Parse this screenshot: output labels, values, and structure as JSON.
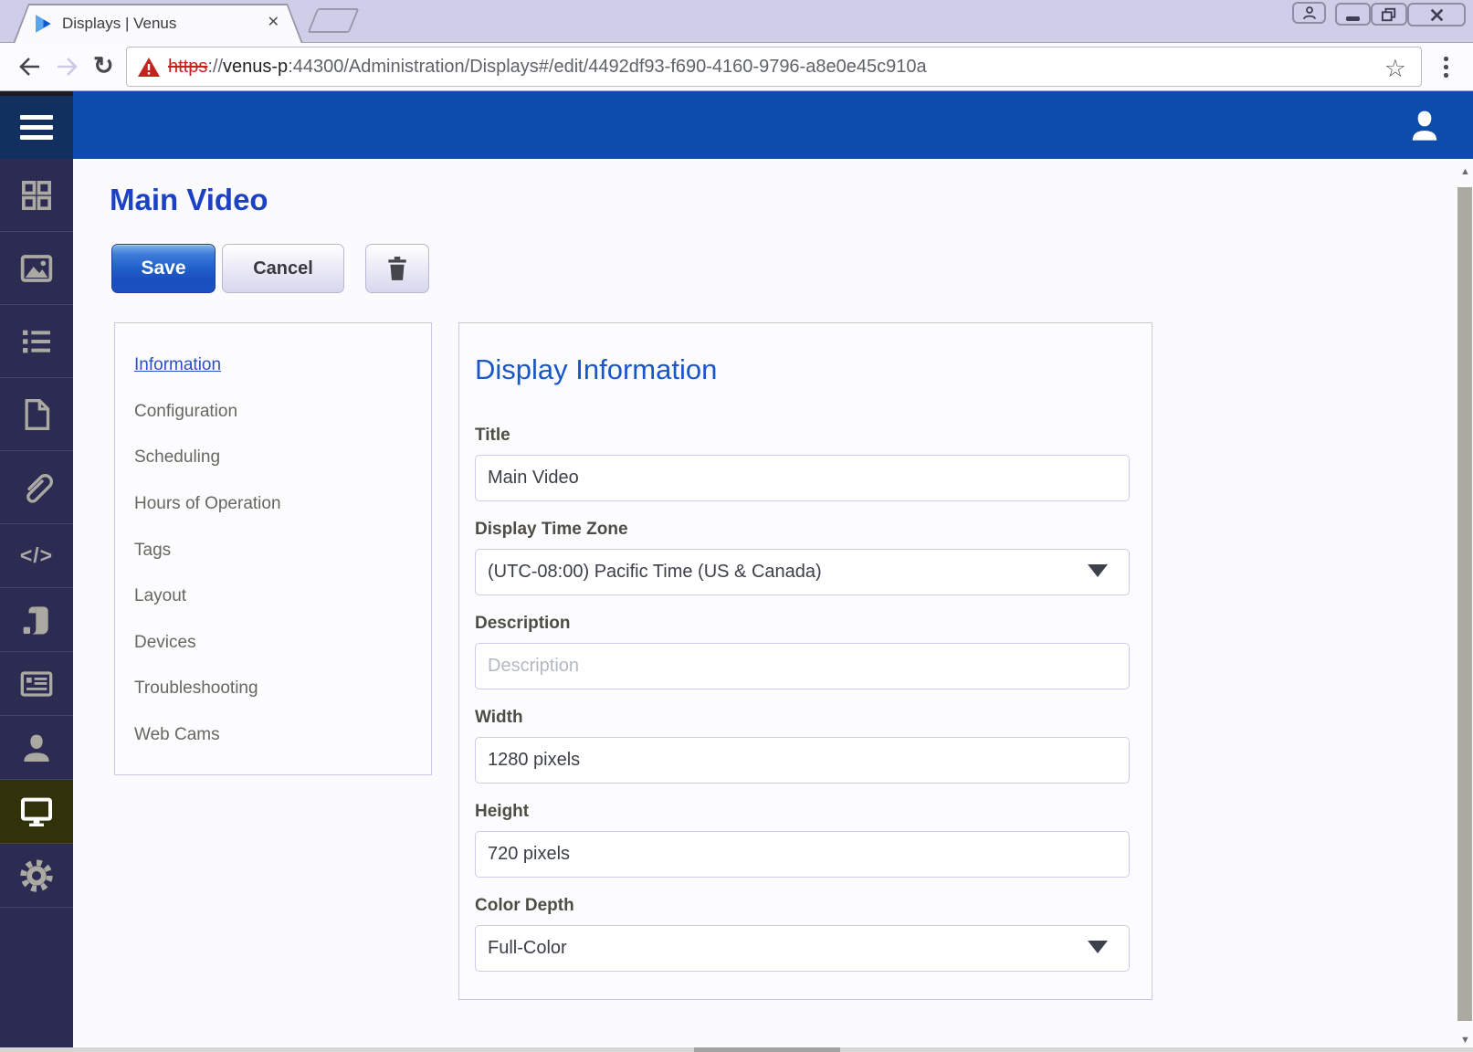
{
  "browser": {
    "tab": {
      "title": "Displays | Venus",
      "close_glyph": "✕"
    },
    "new_tab_button": true,
    "url": {
      "scheme": "https",
      "separator": "://",
      "host": "venus-p",
      "rest": ":44300/Administration/Displays#/edit/4492df93-f690-4160-9796-a8e0e45c910a"
    },
    "nav": {
      "reload": "↻",
      "bookmark_star": "☆"
    }
  },
  "app": {
    "page_title": "Main Video",
    "toolbar": {
      "save_label": "Save",
      "cancel_label": "Cancel"
    },
    "nav_panel": {
      "items": [
        {
          "label": "Information",
          "active": true
        },
        {
          "label": "Configuration"
        },
        {
          "label": "Scheduling"
        },
        {
          "label": "Hours of Operation"
        },
        {
          "label": "Tags"
        },
        {
          "label": "Layout"
        },
        {
          "label": "Devices"
        },
        {
          "label": "Troubleshooting"
        },
        {
          "label": "Web Cams"
        }
      ]
    },
    "form": {
      "heading": "Display Information",
      "fields": [
        {
          "label": "Title",
          "type": "text",
          "value": "Main Video"
        },
        {
          "label": "Display Time Zone",
          "type": "select",
          "value": "(UTC-08:00) Pacific Time (US & Canada)"
        },
        {
          "label": "Description",
          "type": "text",
          "value": "",
          "placeholder": "Description"
        },
        {
          "label": "Width",
          "type": "text",
          "value": "1280 pixels"
        },
        {
          "label": "Height",
          "type": "text",
          "value": "720 pixels"
        },
        {
          "label": "Color Depth",
          "type": "select",
          "value": "Full-Color"
        }
      ]
    },
    "sidebar_icons": [
      "dashboard-grid",
      "image",
      "list",
      "document",
      "paperclip",
      "code",
      "script",
      "card",
      "person",
      "monitor",
      "gear"
    ],
    "sidebar_selected": "monitor"
  },
  "colors": {
    "header_blue": "#0d4cab",
    "hamburger_navy": "#11305f",
    "sidebar_navy": "#2c2b52",
    "selected_olive": "#32320a",
    "title_blue": "#1c41c4",
    "heading_blue": "#1a56c8",
    "link_blue": "#2b4fc9",
    "save_blue": "#2161ca",
    "url_error_red": "#c5221f"
  }
}
